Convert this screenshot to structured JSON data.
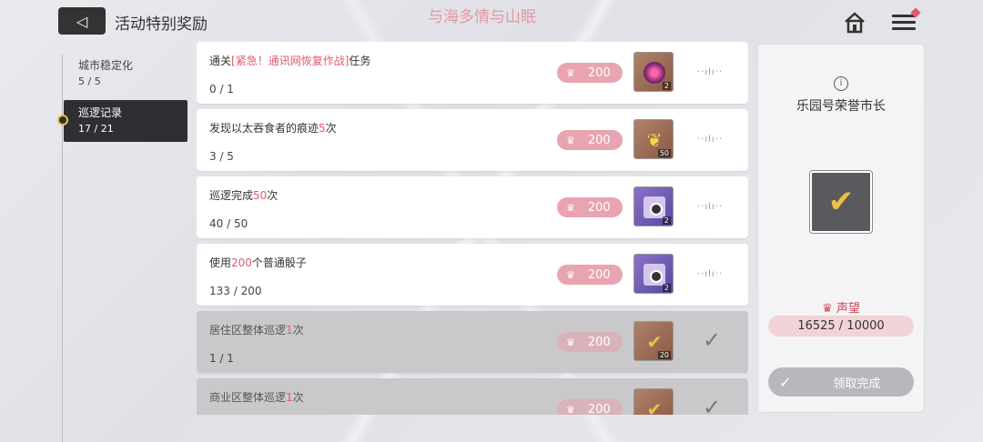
{
  "header": {
    "back_icon": "◁",
    "title": "活动特别奖励",
    "banner": "与海多情与山眠"
  },
  "sidebar": {
    "items": [
      {
        "label": "城市稳定化",
        "count": "5 / 5"
      },
      {
        "label": "巡逻记录",
        "count": "17 / 21"
      }
    ]
  },
  "tasks": [
    {
      "pre": "通关",
      "hl": "[紧急！通讯网恢复作战]",
      "post": "任务",
      "progress": "0 / 1",
      "reward": "200",
      "qty": "2",
      "status": "pending"
    },
    {
      "pre": "发现以太吞食者的痕迹",
      "hl": "5",
      "post": "次",
      "progress": "3 / 5",
      "reward": "200",
      "qty": "50",
      "status": "pending"
    },
    {
      "pre": "巡逻完成",
      "hl": "50",
      "post": "次",
      "progress": "40 / 50",
      "reward": "200",
      "qty": "2",
      "status": "pending"
    },
    {
      "pre": "使用",
      "hl": "200",
      "post": "个普通骰子",
      "progress": "133 / 200",
      "reward": "200",
      "qty": "2",
      "status": "pending"
    },
    {
      "pre": "居住区整体巡逻",
      "hl": "1",
      "post": "次",
      "progress": "1 / 1",
      "reward": "200",
      "qty": "20",
      "status": "done"
    },
    {
      "pre": "商业区整体巡逻",
      "hl": "1",
      "post": "次",
      "progress": "",
      "reward": "200",
      "qty": "",
      "status": "done"
    }
  ],
  "panel": {
    "title": "乐园号荣誉市长",
    "reputation_label": "声望",
    "reputation_value": "16525 / 10000",
    "claim_label": "领取完成"
  },
  "colors": {
    "accent": "#e05a6b",
    "reputation_pill": "#e8a4b0",
    "active_tab": "#2f2f33"
  }
}
